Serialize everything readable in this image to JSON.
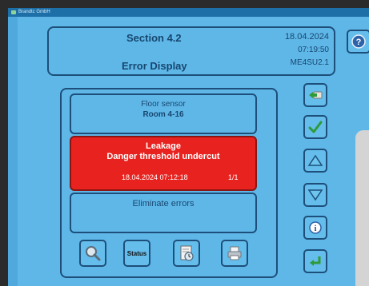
{
  "window": {
    "title": "Brandtc GmbH"
  },
  "header": {
    "section": "Section 4.2",
    "screen_title": "Error Display",
    "date": "18.04.2024",
    "time": "07:19:50",
    "device": "ME4SU2.1"
  },
  "sensor": {
    "label": "Floor sensor",
    "room": "Room 4-16"
  },
  "alarm": {
    "title": "Leakage",
    "message": "Danger threshold undercut",
    "timestamp": "18.04.2024 07:12:18",
    "counter": "1/1",
    "color": "#e8231f"
  },
  "action": {
    "label": "Eliminate errors"
  },
  "toolbar": {
    "status_label": "Status"
  },
  "side_buttons": [
    "back-folder-icon",
    "check-icon",
    "arrow-up-icon",
    "arrow-down-icon",
    "info-icon",
    "enter-icon"
  ],
  "icons": [
    "magnifier-icon",
    "document-clock-icon",
    "printer-icon",
    "help-icon"
  ],
  "colors": {
    "background": "#5fb7e8",
    "border": "#1d4f7a",
    "alarm": "#e8231f"
  }
}
